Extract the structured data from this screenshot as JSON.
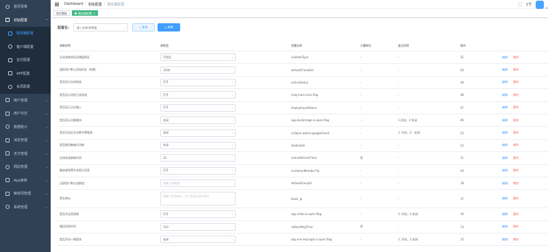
{
  "sidebar": {
    "items": [
      {
        "label": "首页看板",
        "level": 0,
        "icon": "dashboard-icon"
      },
      {
        "label": "初始配置",
        "level": 0,
        "icon": "settings-icon",
        "open": true
      },
      {
        "label": "服务器配置",
        "level": 1,
        "icon": "server-icon",
        "active": true
      },
      {
        "label": "客户端配置",
        "level": 1,
        "icon": "client-icon"
      },
      {
        "label": "支付配置",
        "level": 1,
        "icon": "payment-icon"
      },
      {
        "label": "APP配置",
        "level": 1,
        "icon": "app-icon"
      },
      {
        "label": "会员配置",
        "level": 1,
        "icon": "member-icon"
      },
      {
        "label": "用户管理",
        "level": 0,
        "icon": "user-icon"
      },
      {
        "label": "用户日志",
        "level": 0,
        "icon": "log-icon"
      },
      {
        "label": "数据统计",
        "level": 0,
        "icon": "stats-icon"
      },
      {
        "label": "消息管理",
        "level": 0,
        "icon": "message-icon"
      },
      {
        "label": "支付管理",
        "level": 0,
        "icon": "pay-manage-icon"
      },
      {
        "label": "网站管理",
        "level": 0,
        "icon": "website-icon"
      },
      {
        "label": "App审核",
        "level": 0,
        "icon": "app-review-icon"
      },
      {
        "label": "敏感词管理",
        "level": 0,
        "icon": "sensitive-icon"
      },
      {
        "label": "系统管理",
        "level": 0,
        "icon": "system-icon"
      }
    ]
  },
  "header": {
    "breadcrumb": [
      "Dashboard",
      "初始配置",
      "服务器配置"
    ]
  },
  "tags": {
    "home": "首页看板",
    "active": "服务器配置",
    "accent": "#42b983"
  },
  "search": {
    "label": "配置名:",
    "placeholder": "输入名称/参数值",
    "query_btn": "查询",
    "add_btn": "新增"
  },
  "table": {
    "headers": [
      "参数说明",
      "参数值",
      "变量名称",
      "计量单位",
      "备注说明",
      "操作"
    ],
    "edit_label": "编辑",
    "delete_label": "删除",
    "rows": [
      {
        "desc": "开启游戏验证码弹窗验证",
        "ctl": "select",
        "value": "不验证",
        "var": "validateType",
        "unit": "-",
        "note": "-",
        "id": "51"
      },
      {
        "desc": "虚拟用户默认添加时长（秒数）",
        "ctl": "input",
        "value": "1000",
        "var": "defaultFriendUid",
        "unit": "-",
        "note": "-",
        "id": "50"
      },
      {
        "desc": "是否显示在线状态",
        "ctl": "select",
        "value": "打开",
        "var": "onlineStatus",
        "unit": "-",
        "note": "-",
        "id": "49"
      },
      {
        "desc": "是否显示消息已读状态",
        "ctl": "select",
        "value": "打开",
        "var": "msg.read.cross.flag",
        "unit": "-",
        "note": "-",
        "id": "48"
      },
      {
        "desc": "是否显示正在输入",
        "ctl": "select",
        "value": "打开",
        "var": "displayInputStatus",
        "unit": "-",
        "note": "-",
        "id": "47"
      },
      {
        "desc": "是否显示切换模块",
        "ctl": "select",
        "value": "关闭",
        "var": "app.backimage.is.open.flag",
        "unit": "-",
        "note": "1:开启，2:关闭",
        "id": "46"
      },
      {
        "desc": "是否开启后台谷歌令牌登录",
        "ctl": "select",
        "value": "关闭",
        "var": "ecOpen.admin.googleCheck",
        "unit": "-",
        "note": "1: 开启；2：关闭",
        "id": "23"
      },
      {
        "desc": "是否使用敏感词功能",
        "ctl": "select",
        "value": "关闭",
        "var": "illwEnable",
        "unit": "-",
        "note": "-",
        "id": "22"
      },
      {
        "desc": "在线状态刷新时间",
        "ctl": "input",
        "value": "10",
        "var": "onlineRefreshTime",
        "unit": "秒",
        "note": "-",
        "id": "21"
      },
      {
        "desc": "撤退或免费开关提示消息",
        "ctl": "select",
        "value": "打开",
        "var": "invitationMemberTip",
        "unit": "-",
        "note": "-",
        "id": "20"
      },
      {
        "desc": "注册用户默认进群组",
        "ctl": "input-ph",
        "value": "请输入参数值",
        "var": "defaultGroupId",
        "unit": "-",
        "note": "-",
        "id": "18"
      },
      {
        "desc": "黑名单ip",
        "ctl": "textarea",
        "value": "请输入黑名单ip，多个用英文逗号隔开",
        "var": "black_ip",
        "unit": "-",
        "note": "-",
        "id": "17"
      },
      {
        "desc": "是否开启音视频",
        "ctl": "select",
        "value": "打开",
        "var": "app.video.is.open.flag",
        "unit": "-",
        "note": "1: 开启；2:关闭",
        "id": "16"
      },
      {
        "desc": "撤回消息时间",
        "ctl": "input",
        "value": "120",
        "var": "reBackMsgTime",
        "unit": "秒",
        "note": "-",
        "id": "13"
      },
      {
        "desc": "是否开启一键登录",
        "ctl": "select",
        "value": "关闭",
        "var": "app.one.key.login.is.open.flag",
        "unit": "-",
        "note": "1: 开启，2:关闭",
        "id": "12"
      }
    ]
  },
  "colors": {
    "sidebar_bg": "#304156",
    "primary": "#409eff",
    "danger": "#f56c6c"
  }
}
